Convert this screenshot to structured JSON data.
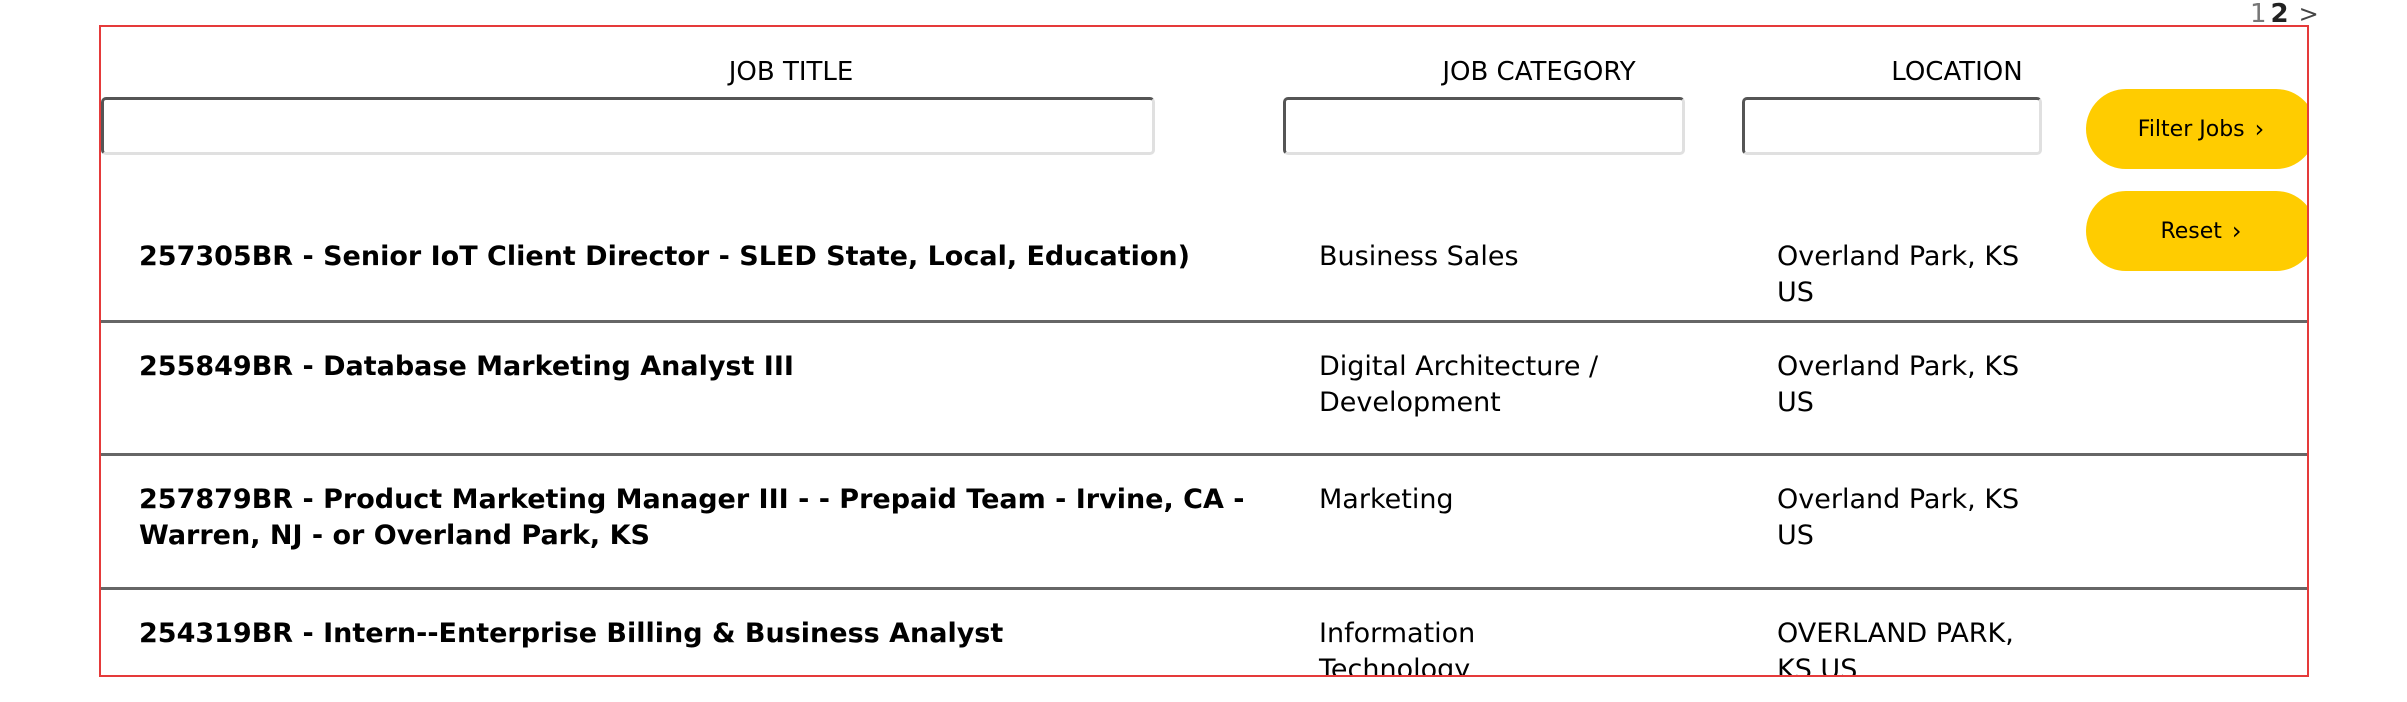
{
  "pagination": {
    "prev_page": "1",
    "current_page": "2",
    "next_label": ">"
  },
  "headers": {
    "job_title": "JOB TITLE",
    "job_category": "JOB CATEGORY",
    "location": "LOCATION"
  },
  "filters": {
    "job_title_value": "",
    "job_category_value": "",
    "location_value": ""
  },
  "buttons": {
    "filter_label": "Filter Jobs",
    "reset_label": "Reset",
    "chevron": "›"
  },
  "jobs": [
    {
      "title": "257305BR - Senior IoT Client Director - SLED State, Local, Education)",
      "category": "Business Sales",
      "location": "Overland Park, KS US"
    },
    {
      "title": "255849BR - Database Marketing Analyst III",
      "category": "Digital Architecture / Development",
      "location": "Overland Park, KS US"
    },
    {
      "title": "257879BR - Product Marketing Manager III - - Prepaid Team - Irvine, CA - Warren, NJ - or Overland Park, KS",
      "category": "Marketing",
      "location": "Overland Park, KS US"
    },
    {
      "title": "254319BR - Intern--Enterprise Billing & Business Analyst",
      "category": "Information Technology",
      "location": "OVERLAND PARK, KS US"
    }
  ],
  "colors": {
    "accent_button": "#ffcc00",
    "frame_border": "#e53a3a",
    "row_divider": "#666666"
  }
}
